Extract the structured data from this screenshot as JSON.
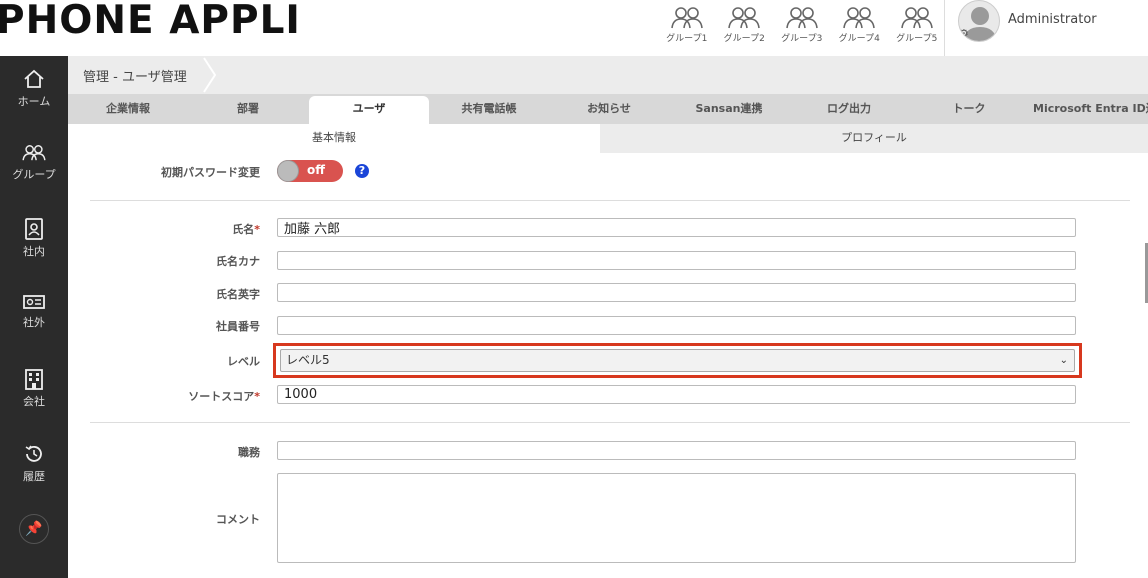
{
  "header": {
    "logo": "PHONE APPLI",
    "groups": [
      "グループ1",
      "グループ2",
      "グループ3",
      "グループ4",
      "グループ5"
    ],
    "user_name": "Administrator"
  },
  "sidebar": {
    "items": [
      {
        "label": "ホーム",
        "icon": "home-icon"
      },
      {
        "label": "グループ",
        "icon": "group-icon"
      },
      {
        "label": "社内",
        "icon": "internal-directory-icon"
      },
      {
        "label": "社外",
        "icon": "contact-card-icon"
      },
      {
        "label": "会社",
        "icon": "building-icon"
      },
      {
        "label": "履歴",
        "icon": "history-icon"
      }
    ],
    "pin_icon": "pin-icon"
  },
  "breadcrumb": "管理 - ユーザ管理",
  "tabs": [
    "企業情報",
    "部署",
    "ユーザ",
    "共有電話帳",
    "お知らせ",
    "Sansan連携",
    "ログ出力",
    "トーク",
    "Microsoft Entra ID連携"
  ],
  "active_tab": "ユーザ",
  "subtabs": [
    "基本情報",
    "プロフィール"
  ],
  "form": {
    "password_change_label": "初期パスワード変更",
    "toggle_text": "off",
    "help_text": "?",
    "name_label": "氏名",
    "name_value": "加藤 六郎",
    "kana_label": "氏名カナ",
    "kana_value": "",
    "english_label": "氏名英字",
    "english_value": "",
    "employee_no_label": "社員番号",
    "employee_no_value": "",
    "level_label": "レベル",
    "level_value": "レベル5",
    "sort_label": "ソートスコア",
    "sort_value": "1000",
    "position_label": "職務",
    "position_value": "",
    "comment_label": "コメント",
    "required_mark": "*"
  },
  "colors": {
    "sidebar_bg": "#2b2b2b",
    "toggle_off": "#d9534f",
    "highlight": "#d7381e",
    "help": "#1a45d8"
  }
}
